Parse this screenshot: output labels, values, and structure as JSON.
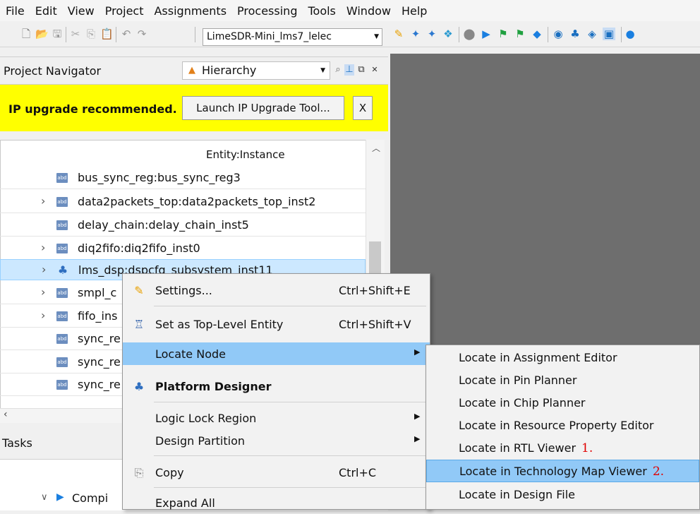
{
  "menubar": [
    "File",
    "Edit",
    "View",
    "Project",
    "Assignments",
    "Processing",
    "Tools",
    "Window",
    "Help"
  ],
  "toolbar": {
    "revision": "LimeSDR-Mini_lms7_lelec"
  },
  "navigator": {
    "title": "Project Navigator",
    "view": "Hierarchy",
    "banner": {
      "message": "IP upgrade recommended.",
      "button": "Launch IP Upgrade Tool...",
      "close": "X"
    },
    "column_header": "Entity:Instance",
    "rows": [
      {
        "label": "bus_sync_reg:bus_sync_reg3",
        "expandable": false,
        "icon": "abd-entity-icon"
      },
      {
        "label": "data2packets_top:data2packets_top_inst2",
        "expandable": true,
        "icon": "abd-entity-icon"
      },
      {
        "label": "delay_chain:delay_chain_inst5",
        "expandable": false,
        "icon": "abd-entity-icon"
      },
      {
        "label": "diq2fifo:diq2fifo_inst0",
        "expandable": true,
        "icon": "abd-entity-icon"
      },
      {
        "label": "lms_dsp:dspcfg_subsystem_inst11",
        "expandable": true,
        "icon": "hierarchy-icon",
        "selected": true
      },
      {
        "label": "smpl_c",
        "expandable": true,
        "icon": "abd-entity-icon"
      },
      {
        "label": "fifo_ins",
        "expandable": true,
        "icon": "abd-entity-icon"
      },
      {
        "label": "sync_re",
        "expandable": false,
        "icon": "abd-entity-icon"
      },
      {
        "label": "sync_re",
        "expandable": false,
        "icon": "abd-entity-icon"
      },
      {
        "label": "sync_re",
        "expandable": false,
        "icon": "abd-entity-icon"
      }
    ]
  },
  "tasks": {
    "title": "Tasks",
    "item": "Compi"
  },
  "context_menu": {
    "items": [
      {
        "label": "Settings...",
        "shortcut": "Ctrl+Shift+E",
        "icon": "pencil-icon"
      },
      {
        "label": "Set as Top-Level Entity",
        "shortcut": "Ctrl+Shift+V",
        "icon": "top-level-icon"
      },
      {
        "label": "Locate Node",
        "shortcut": "",
        "icon": "",
        "submenu": true,
        "highlighted": true
      },
      {
        "label": "Platform Designer",
        "shortcut": "",
        "icon": "platform-designer-icon",
        "bold": true
      },
      {
        "label": "Logic Lock Region",
        "shortcut": "",
        "icon": "",
        "submenu": true
      },
      {
        "label": "Design Partition",
        "shortcut": "",
        "icon": "",
        "submenu": true
      },
      {
        "label": "Copy",
        "shortcut": "Ctrl+C",
        "icon": "copy-icon"
      },
      {
        "label": "Expand All",
        "shortcut": "",
        "icon": ""
      }
    ]
  },
  "locate_submenu": {
    "items": [
      {
        "label": "Locate in Assignment Editor",
        "annotation": ""
      },
      {
        "label": "Locate in Pin Planner",
        "annotation": ""
      },
      {
        "label": "Locate in Chip Planner",
        "annotation": ""
      },
      {
        "label": "Locate in Resource Property Editor",
        "annotation": ""
      },
      {
        "label": "Locate in RTL Viewer",
        "annotation": "1."
      },
      {
        "label": "Locate in Technology Map Viewer",
        "annotation": "2.",
        "highlighted": true
      },
      {
        "label": "Locate in Design File",
        "annotation": ""
      }
    ]
  },
  "colors": {
    "banner": "#ffff00",
    "selection": "#cce8ff",
    "menu_highlight": "#91c9f7",
    "annotation": "#e00000",
    "workspace": "#6e6e6e"
  }
}
